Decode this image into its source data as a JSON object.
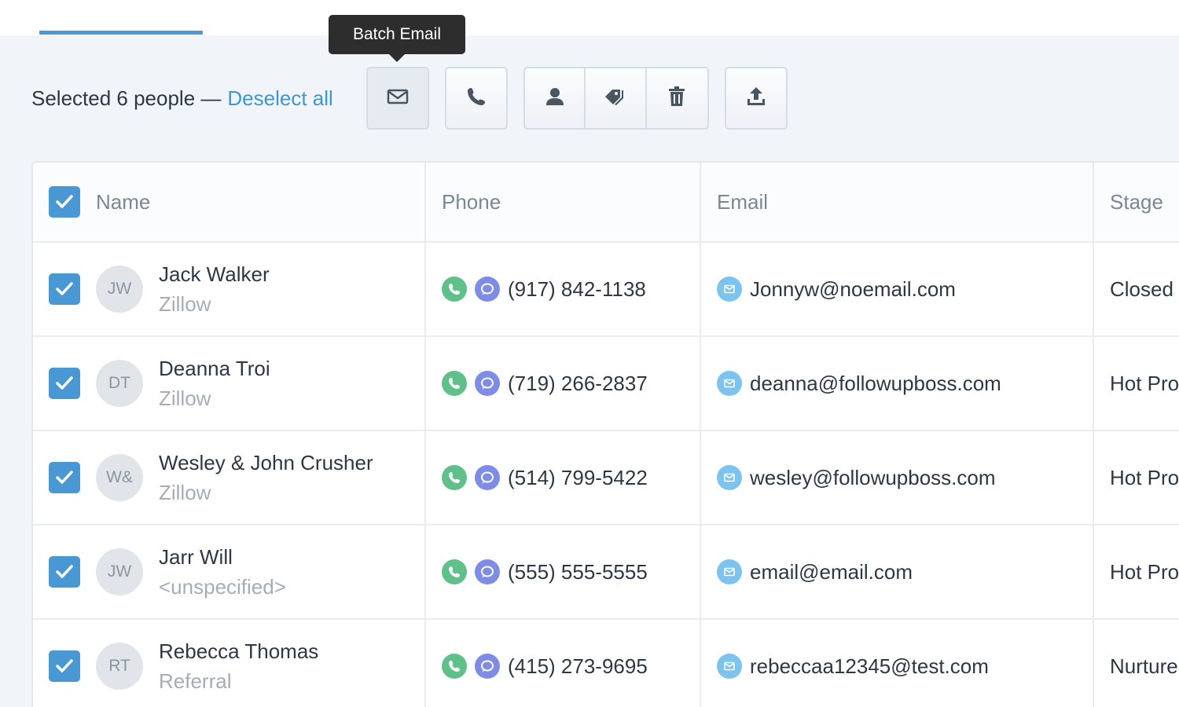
{
  "tooltip": {
    "text": "Batch Email"
  },
  "selection": {
    "summary": "Selected 6 people —",
    "deselect_label": "Deselect all"
  },
  "toolbar": {
    "buttons": [
      {
        "name": "batch-email",
        "icon": "envelope-icon"
      },
      {
        "name": "batch-call",
        "icon": "phone-icon"
      },
      {
        "name": "assign-agent",
        "icon": "person-icon"
      },
      {
        "name": "tag",
        "icon": "tag-icon"
      },
      {
        "name": "delete",
        "icon": "trash-icon"
      },
      {
        "name": "export",
        "icon": "upload-icon"
      }
    ]
  },
  "table": {
    "columns": {
      "name": "Name",
      "phone": "Phone",
      "email": "Email",
      "stage": "Stage"
    },
    "rows": [
      {
        "initials": "JW",
        "name": "Jack Walker",
        "source": "Zillow",
        "phone": "(917) 842-1138",
        "email": "Jonnyw@noemail.com",
        "stage": "Closed"
      },
      {
        "initials": "DT",
        "name": "Deanna Troi",
        "source": "Zillow",
        "phone": "(719) 266-2837",
        "email": "deanna@followupboss.com",
        "stage": "Hot Prospect"
      },
      {
        "initials": "W&",
        "name": "Wesley & John Crusher",
        "source": "Zillow",
        "phone": "(514) 799-5422",
        "email": "wesley@followupboss.com",
        "stage": "Hot Prospect"
      },
      {
        "initials": "JW",
        "name": "Jarr Will",
        "source": "<unspecified>",
        "phone": "(555) 555-5555",
        "email": "email@email.com",
        "stage": "Hot Prospect"
      },
      {
        "initials": "RT",
        "name": "Rebecca Thomas",
        "source": "Referral",
        "phone": "(415) 273-9695",
        "email": "rebeccaa12345@test.com",
        "stage": "Nurture"
      }
    ]
  },
  "colors": {
    "accent": "#4a98d3",
    "link": "#3f97d2",
    "call": "#5fc08a",
    "text": "#7f8ce6",
    "email": "#7cc4ef"
  }
}
